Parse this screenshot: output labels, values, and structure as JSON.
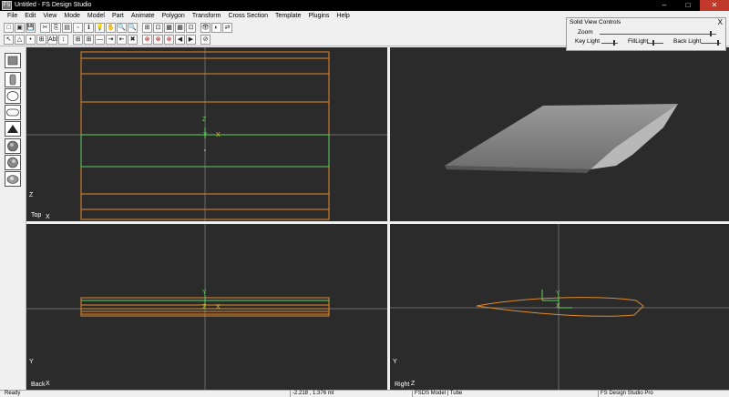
{
  "window": {
    "title": "Untitled - FS Design Studio",
    "app_icon": "FS",
    "minimize": "–",
    "maximize": "□",
    "close": "✕"
  },
  "menu": [
    "File",
    "Edit",
    "View",
    "Mode",
    "Model",
    "Part",
    "Animate",
    "Polygon",
    "Transform",
    "Cross Section",
    "Template",
    "Plugins",
    "Help"
  ],
  "toolbar1": [
    "□",
    "▣",
    "💾",
    "✂",
    "⎘",
    "▤",
    "▫",
    "ℹ",
    "💡",
    "✋",
    "🔍",
    "🔍",
    "⊞",
    "⊡",
    "▦",
    "▦",
    "⊡",
    "👁",
    "◐",
    "⇄"
  ],
  "toolbar2": [
    "↖",
    "△",
    "•",
    "⊞",
    "Abl",
    "↕",
    "⊞",
    "⊞",
    "—",
    "⇥",
    "⇤",
    "✖",
    "⊗",
    "⊗",
    "⊗",
    "◀",
    "▶",
    "⊘"
  ],
  "shapes": [
    "cube",
    "cylinder",
    "sphere",
    "capsule",
    "wedge",
    "globe-a",
    "globe-b",
    "globe-c"
  ],
  "viewports": {
    "top": {
      "label": "Top",
      "axis_v": "Z",
      "axis_h": "X"
    },
    "perspective": {
      "label": ""
    },
    "back": {
      "label": "Back",
      "axis_v": "Y",
      "axis_h": "X"
    },
    "right": {
      "label": "Right",
      "axis_v": "Y",
      "axis_h": "Z"
    }
  },
  "origin_labels": {
    "z": "Z",
    "y": "Y",
    "x": "X"
  },
  "status": {
    "ready": "Ready",
    "coords": "-2.218 , 1.376 mt",
    "model": "FSDS Model | Tube",
    "app": "FS Design Studio Pro"
  },
  "solid_view_controls": {
    "title": "Solid View Controls",
    "close": "X",
    "zoom": "Zoom",
    "key_light": "Key Light",
    "fill_light": "FillLight",
    "back_light": "Back Light"
  },
  "colors": {
    "viewport_bg": "#2b2b2b",
    "outline": "#e08a2a",
    "selected": "#5fd35f",
    "grid": "#6a6a6a"
  }
}
